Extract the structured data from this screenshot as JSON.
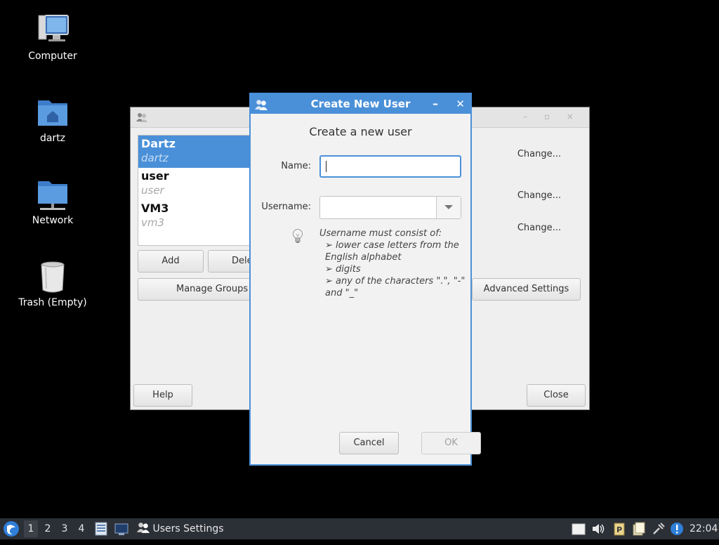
{
  "desktop": {
    "icons": [
      {
        "label": "Computer",
        "icon": "computer-icon"
      },
      {
        "label": "dartz",
        "icon": "home-folder-icon"
      },
      {
        "label": "Network",
        "icon": "network-folder-icon"
      },
      {
        "label": "Trash (Empty)",
        "icon": "trash-icon"
      }
    ]
  },
  "users_window": {
    "users": [
      {
        "name": "Dartz",
        "login": "dartz",
        "selected": true
      },
      {
        "name": "user",
        "login": "user"
      },
      {
        "name": "VM3",
        "login": "vm3"
      }
    ],
    "add_label": "Add",
    "delete_label": "Dele",
    "manage_groups_label": "Manage Groups",
    "change_labels": [
      "Change...",
      "Change...",
      "Change..."
    ],
    "advanced_settings_label": "Advanced Settings",
    "help_label": "Help",
    "close_label": "Close",
    "title_controls": "– ▫ ×"
  },
  "dialog": {
    "title": "Create New User",
    "minimize_glyph": "–",
    "close_glyph": "✕",
    "heading": "Create a new user",
    "name_label": "Name:",
    "name_value": "",
    "username_label": "Username:",
    "username_value": "",
    "hint": {
      "title": "Username must consist of:",
      "rule1": "➢ lower case letters from the English alphabet",
      "rule2": "➢ digits",
      "rule3": "➢ any of the characters \".\", \"-\" and \"_\""
    },
    "cancel_label": "Cancel",
    "ok_label": "OK"
  },
  "taskbar": {
    "workspaces": [
      "1",
      "2",
      "3",
      "4"
    ],
    "active_workspace": "1",
    "task_label": "Users Settings",
    "clock": "22:04"
  },
  "colors": {
    "accent": "#4a90d9",
    "taskbar": "#2b2f36",
    "desktop": "#000000"
  }
}
